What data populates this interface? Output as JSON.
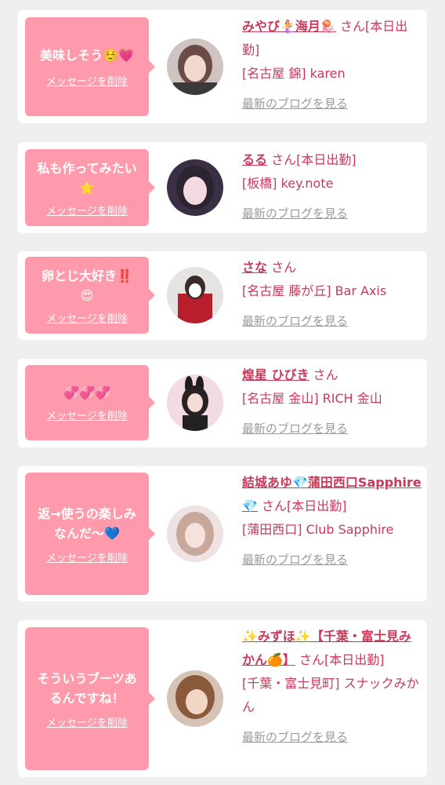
{
  "cards": [
    {
      "message": "美味しそう☺️💗",
      "delete_label": "メッセージを削除",
      "name": "みやび🧜‍♀️海月🪼",
      "suffix": "さん[本日出勤]",
      "shop": "[名古屋 錦] karen",
      "blog_label": "最新のブログを見る"
    },
    {
      "message": "私も作ってみたい⭐️",
      "delete_label": "メッセージを削除",
      "name": "るる",
      "suffix": "さん[本日出勤]",
      "shop": "[板橋] key.note",
      "blog_label": "最新のブログを見る"
    },
    {
      "message": "卵とじ大好き‼️😍",
      "delete_label": "メッセージを削除",
      "name": "さな",
      "suffix": "さん",
      "shop": "[名古屋 藤が丘] Bar Axis",
      "blog_label": "最新のブログを見る"
    },
    {
      "message": "💞💞💞",
      "delete_label": "メッセージを削除",
      "name": "煌星 ひびき",
      "suffix": "さん",
      "shop": "[名古屋 金山] RICH 金山",
      "blog_label": "最新のブログを見る"
    },
    {
      "message": "返→使うの楽しみなんだ〜💙",
      "delete_label": "メッセージを削除",
      "name": "結城あゆ💎蒲田西口Sapphire💎",
      "suffix": "さん[本日出勤]",
      "shop": "[蒲田西口] Club Sapphire",
      "blog_label": "最新のブログを見る"
    },
    {
      "message": "そういうブーツあるんですね！",
      "delete_label": "メッセージを削除",
      "name": "✨みずほ✨【千葉・富士見みかん🍊】",
      "suffix": "さん[本日出勤]",
      "shop": "[千葉・富士見町] スナックみかん",
      "blog_label": "最新のブログを見る"
    }
  ],
  "colors": {
    "bubble": "#fe9aab",
    "accent": "#c8395a",
    "muted": "#9a9a9a",
    "background": "#efefef"
  }
}
